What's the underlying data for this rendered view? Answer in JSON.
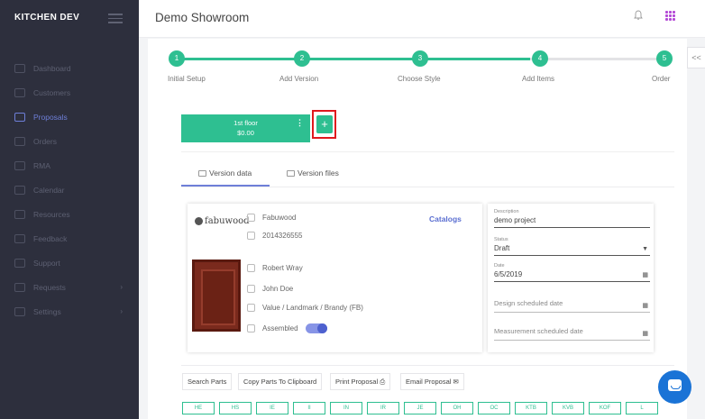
{
  "sidebar": {
    "brand": "KITCHEN DEV",
    "items": [
      {
        "label": "Dashboard",
        "icon": "dashboard-icon"
      },
      {
        "label": "Customers",
        "icon": "customers-icon"
      },
      {
        "label": "Proposals",
        "icon": "proposals-icon",
        "active": true
      },
      {
        "label": "Orders",
        "icon": "orders-icon"
      },
      {
        "label": "RMA",
        "icon": "rma-icon"
      },
      {
        "label": "Calendar",
        "icon": "calendar-icon"
      },
      {
        "label": "Resources",
        "icon": "resources-icon"
      },
      {
        "label": "Feedback",
        "icon": "feedback-icon"
      },
      {
        "label": "Support",
        "icon": "support-icon"
      },
      {
        "label": "Requests",
        "icon": "requests-icon",
        "chevron": "›"
      },
      {
        "label": "Settings",
        "icon": "settings-icon",
        "chevron": "›"
      }
    ]
  },
  "header": {
    "title": "Demo Showroom"
  },
  "collapse_label": "<<",
  "stepper": {
    "steps": [
      {
        "num": "1",
        "label": "Initial Setup"
      },
      {
        "num": "2",
        "label": "Add Version"
      },
      {
        "num": "3",
        "label": "Choose Style"
      },
      {
        "num": "4",
        "label": "Add Items"
      },
      {
        "num": "5",
        "label": "Order"
      }
    ]
  },
  "floor": {
    "name": "1st floor",
    "price": "$0.00",
    "menu": "⋮",
    "add_label": "+"
  },
  "tabs": {
    "version_data": "Version data",
    "version_files": "Version files"
  },
  "info": {
    "brand_logo": "fabuwood",
    "company": "Fabuwood",
    "phone": "2014326555",
    "catalogs": "Catalogs",
    "sales_rep": "Robert Wray",
    "customer": "John Doe",
    "style": "Value / Landmark / Brandy (FB)",
    "assembled_label": "Assembled",
    "assembled": true
  },
  "form": {
    "description_label": "Description",
    "description_value": "demo project",
    "status_label": "Status",
    "status_value": "Draft",
    "date_label": "Date",
    "date_value": "6/5/2019",
    "design_date_placeholder": "Design scheduled date",
    "measurement_date_placeholder": "Measurement scheduled date"
  },
  "actions": {
    "search_parts": "Search Parts",
    "copy_parts": "Copy Parts To Clipboard",
    "print_proposal": "Print Proposal",
    "email_proposal": "Email Proposal"
  },
  "letters": [
    "HE",
    "HS",
    "IE",
    "II",
    "IN",
    "IR",
    "JE",
    "OH",
    "OC",
    "KTB",
    "KVB",
    "KOF",
    "L"
  ],
  "colors": {
    "accent": "#2ebf91",
    "primary": "#6e7fd8",
    "sidebar": "#2d2f3d",
    "highlight": "#e0191e"
  }
}
